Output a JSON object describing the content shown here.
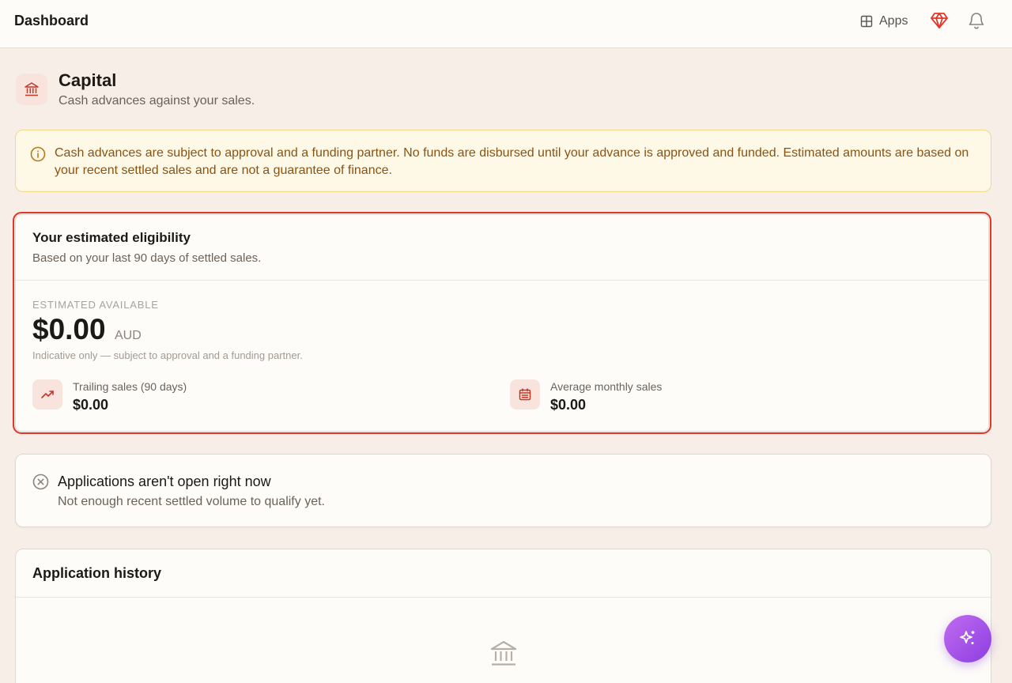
{
  "topbar": {
    "title": "Dashboard",
    "apps_label": "Apps"
  },
  "page": {
    "title": "Capital",
    "subtitle": "Cash advances against your sales."
  },
  "notice": {
    "text": "Cash advances are subject to approval and a funding partner. No funds are disbursed until your advance is approved and funded. Estimated amounts are based on your recent settled sales and are not a guarantee of finance."
  },
  "eligibility": {
    "title": "Your estimated eligibility",
    "subtitle": "Based on your last 90 days of settled sales.",
    "available_label": "ESTIMATED AVAILABLE",
    "amount": "$0.00",
    "currency": "AUD",
    "note": "Indicative only — subject to approval and a funding partner.",
    "stats": [
      {
        "label": "Trailing sales (90 days)",
        "value": "$0.00",
        "icon": "trending-up-icon"
      },
      {
        "label": "Average monthly sales",
        "value": "$0.00",
        "icon": "calendar-icon"
      }
    ]
  },
  "status": {
    "title": "Applications aren't open right now",
    "subtitle": "Not enough recent settled volume to qualify yet."
  },
  "history": {
    "title": "Application history"
  },
  "colors": {
    "accent": "#e1372a",
    "brand_icon": "#c0392b",
    "fab_start": "#c26bf2",
    "fab_end": "#8b3fe0"
  }
}
